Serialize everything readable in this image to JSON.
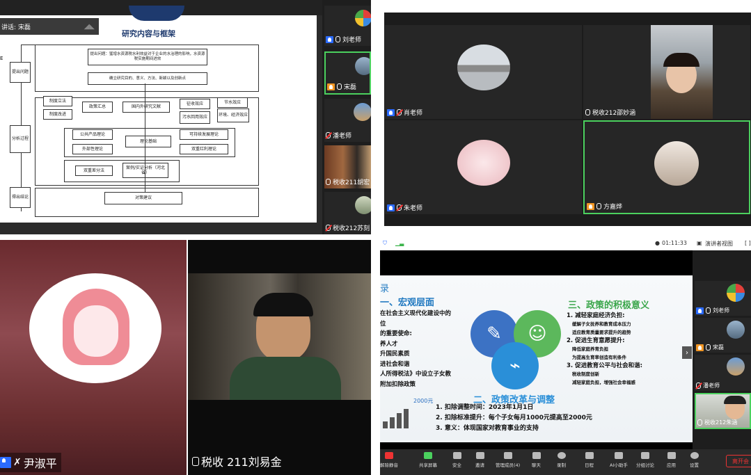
{
  "q1": {
    "speaker_prefix": "讲话:",
    "speaker_name": "宋磊",
    "slide_title": "研究内容与框架",
    "left_steps": [
      "提出问题",
      "分析过程",
      "得出结论"
    ],
    "boxes": {
      "problem": "提出问题：猛增水资源税水利效益对于企业的水治理的影响，水资源税实施期间进效",
      "research": "确立研究目的、意义、方法、新颖以及创新点",
      "domestic": "国内外研究文献",
      "lit": "政策汇总",
      "sys_law": "制度立法",
      "sys_reform": "制度改进",
      "effect": "征收效应",
      "pollution": "污水回用效应",
      "saving": "节水效应",
      "env": "环境、经济效应",
      "public_goods": "公共产品理论",
      "externality": "外部性理论",
      "theory": "理论基础",
      "sustainable": "可持续发展理论",
      "double_dividend": "双重红利理论",
      "diff": "双重差分法",
      "case": "案例/实证分析（河北省）",
      "advice": "对策建议"
    },
    "side_participants": [
      "刘老师",
      "宋磊",
      "潘老师",
      "税收211胡宏",
      "税收212苏刻"
    ]
  },
  "q2": {
    "tiles": [
      "肖老师",
      "税收212邵妙涵",
      "朱老师",
      "方嘉烨"
    ]
  },
  "q3": {
    "name": "尹淑平"
  },
  "q4": {
    "name": "税收 211刘易金"
  },
  "q5": {
    "timer": "01:11:33",
    "view_label": "演讲者视图",
    "heading_left": "一、宏观层面",
    "heading_top_label": "三、政策的积极意义",
    "left_lines": [
      "在社会主义现代化建设中的",
      "位",
      "的重要使命:",
      "养人才",
      "升国民素质",
      "进社会和谐",
      "人所得税法》中设立子女教",
      "附加扣除政策"
    ],
    "heading_left_small": "录",
    "right_items": [
      {
        "title": "1. 减轻家庭经济负担:",
        "subs": [
          "缓解子女抚养和教育成本压力",
          "适应教育质量要求提升的趋势"
        ]
      },
      {
        "title": "2. 促进生育意愿提升:",
        "subs": [
          "降低家庭养育负担",
          "为提高生育率创造有利条件"
        ]
      },
      {
        "title": "3. 促进教育公平与社会和谐:",
        "subs": [
          "税收制度创新",
          "减轻家庭负担，增强社会幸福感"
        ]
      }
    ],
    "heading_mid": "二、政策改革与调整",
    "chart_label": "2000元",
    "bottom_lines": [
      "1. 扣除调整时间：2023年1月1日",
      "2. 扣除标准提升：每个子女每月1000元提高至2000元",
      "3. 意义：体现国家对教育事业的支持"
    ],
    "side_participants": [
      "刘老师",
      "宋磊",
      "潘老师",
      "税收212朱涵"
    ],
    "toolbar": [
      "解除静音",
      "共享屏幕",
      "安全",
      "邀请",
      "管理成员(4)",
      "聊天",
      "录制",
      "日程",
      "AI小助手",
      "分组讨论",
      "应用",
      "设置"
    ],
    "leave_label": "离开会"
  }
}
